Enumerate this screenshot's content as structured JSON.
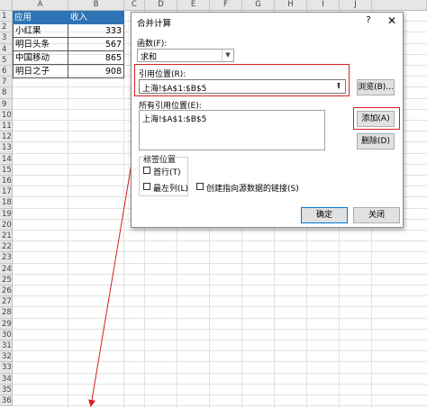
{
  "sheet": {
    "columns": [
      "A",
      "B",
      "C",
      "D",
      "E",
      "F",
      "G",
      "H",
      "I",
      "J"
    ],
    "rows": [
      "1",
      "2",
      "3",
      "4",
      "5",
      "6",
      "7",
      "8",
      "9",
      "10",
      "11",
      "12",
      "13",
      "14",
      "15",
      "16",
      "17",
      "18",
      "19",
      "20",
      "21",
      "22",
      "23",
      "24",
      "25",
      "26",
      "27",
      "28",
      "29",
      "30",
      "31",
      "32",
      "33",
      "34",
      "35",
      "36"
    ],
    "table": {
      "headers": [
        "应用",
        "收入"
      ],
      "rows": [
        {
          "name": "小红果",
          "value": "333"
        },
        {
          "name": "明日头条",
          "value": "567"
        },
        {
          "name": "中国移动",
          "value": "865"
        },
        {
          "name": "明日之子",
          "value": "908"
        }
      ]
    },
    "header_color": "#2e74b5"
  },
  "dialog": {
    "title": "合并计算",
    "help": "?",
    "close": "✕",
    "function_label": "函数(F):",
    "function_value": "求和",
    "reference_label": "引用位置(R):",
    "reference_value": "上海!$A$1:$B$5",
    "browse_button": "浏览(B)...",
    "all_refs_label": "所有引用位置(E):",
    "all_refs": [
      "上海!$A$1:$B$5"
    ],
    "add_button": "添加(A)",
    "delete_button": "删除(D)",
    "labels_group": "标签位置",
    "first_row": "首行(T)",
    "left_column": "最左列(L)",
    "create_links": "创建指向源数据的链接(S)",
    "ok_button": "确定",
    "close_button": "关闭",
    "annotation_color": "#d32020"
  }
}
